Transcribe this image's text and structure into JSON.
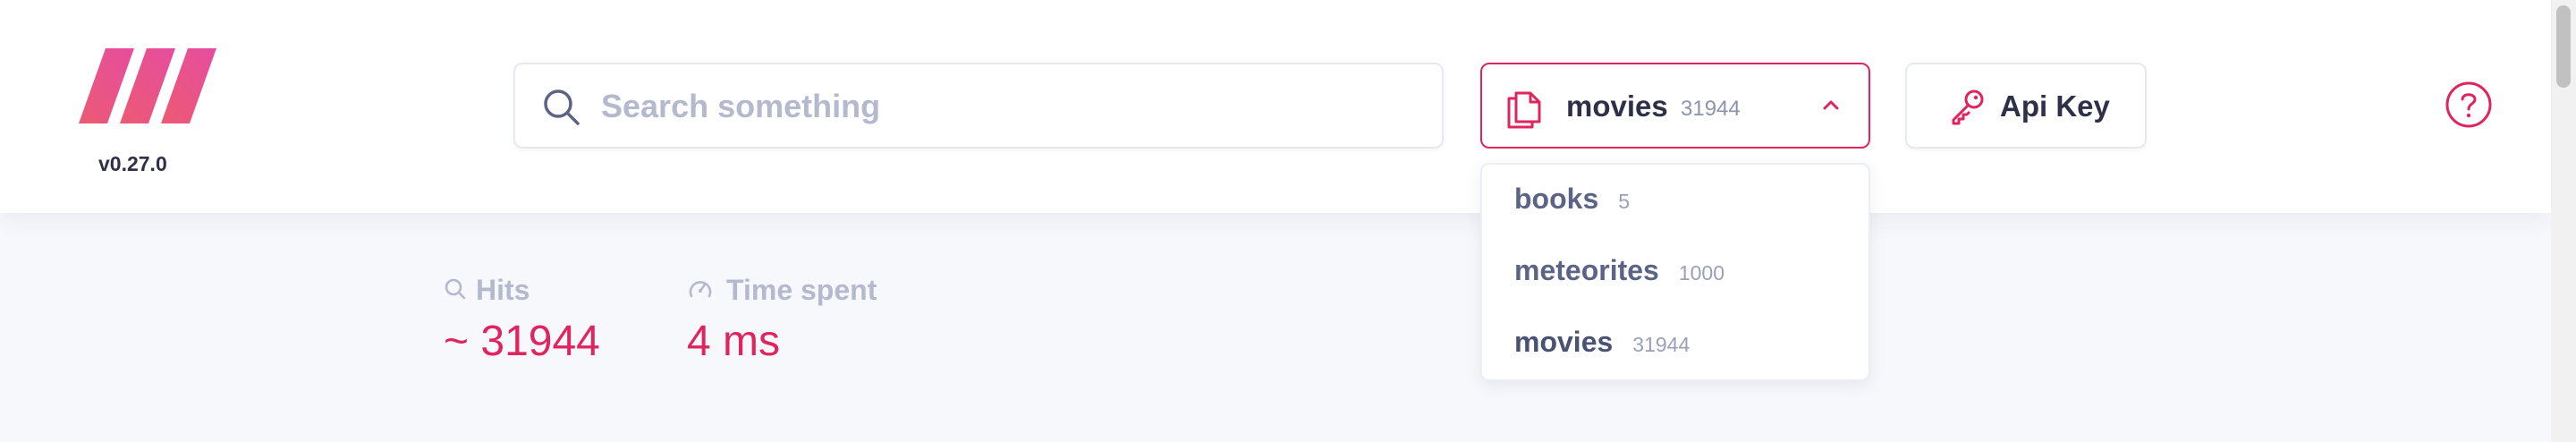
{
  "header": {
    "version": "v0.27.0",
    "search": {
      "placeholder": "Search something",
      "value": ""
    },
    "index_selector": {
      "selected_name": "movies",
      "selected_count": "31944",
      "expanded": true
    },
    "api_key_label": "Api Key"
  },
  "dropdown": {
    "items": [
      {
        "name": "books",
        "count": "5"
      },
      {
        "name": "meteorites",
        "count": "1000"
      },
      {
        "name": "movies",
        "count": "31944",
        "selected": true
      }
    ]
  },
  "stats": {
    "hits_label": "Hits",
    "hits_value": "~ 31944",
    "time_label": "Time spent",
    "time_value": "4 ms"
  },
  "colors": {
    "accent": "#e0245e",
    "logo_gradient_start": "#ec5a72",
    "logo_gradient_end": "#e64da0",
    "text": "#2d3047",
    "muted": "#b4b9cd"
  },
  "icons": {
    "search": "search-icon",
    "selector": "documents-icon",
    "chevron": "chevron-up-icon",
    "api_key": "key-icon",
    "help": "question-circle-icon",
    "hits": "search-icon",
    "time": "speedometer-icon"
  }
}
